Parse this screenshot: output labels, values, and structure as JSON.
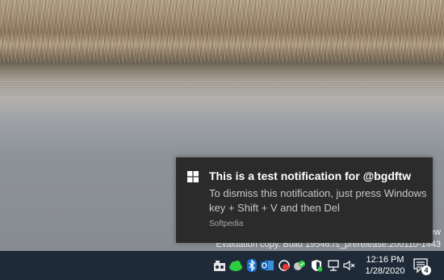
{
  "desktop": {
    "watermark_partial": "ew",
    "evaluation_text": "Evaluation copy. Build 19546.rs_prerelease.200110-1443"
  },
  "notification": {
    "title": "This is a test notification for @bgdftw",
    "body": "To dismiss this notification, just press Windows key + Shift + V and then Del",
    "attribution": "Softpedia",
    "app_icon": "windows-logo-icon",
    "background_color": "#2b2b2b"
  },
  "taskbar": {
    "background_color": "#1f2a38",
    "tray_icons": [
      "dev-tool-icon",
      "green-cloud-icon",
      "bluetooth-icon",
      "outlook-icon",
      "red-tool-icon",
      "green-check-shield-icon",
      "security-shield-icon",
      "network-icon",
      "speaker-muted-icon"
    ],
    "clock": {
      "time": "12:16 PM",
      "date": "1/28/2020"
    },
    "action_center": {
      "icon": "action-center-icon",
      "badge_count": "4"
    }
  }
}
